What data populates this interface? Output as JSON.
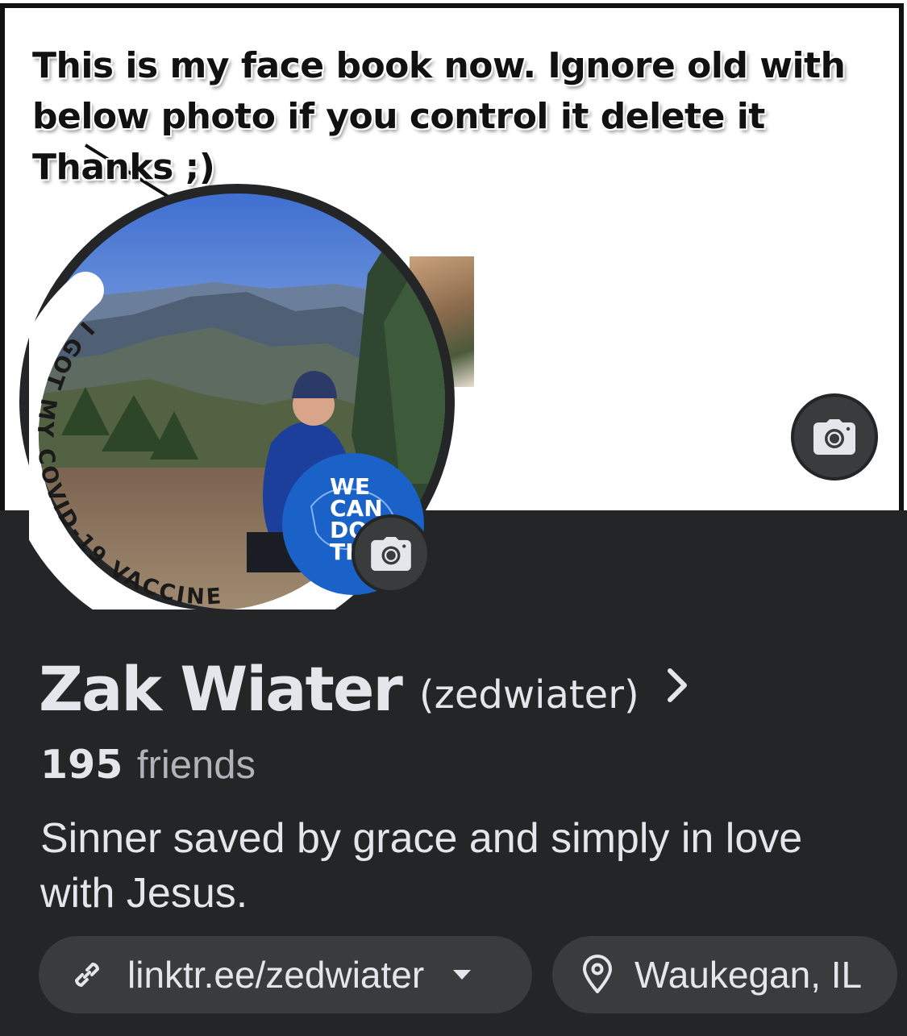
{
  "cover": {
    "caption": "This is my face book now. Ignore old with below photo if you control it delete it Thanks ;)",
    "camera_icon": "camera-icon"
  },
  "avatar": {
    "frame_text": "I GOT MY COVID-19 VACCINE",
    "badge_text": [
      "WE",
      "CAN",
      "DO",
      "TH"
    ],
    "camera_icon": "camera-icon"
  },
  "profile": {
    "name": "Zak Wiater",
    "username": "(zedwiater)",
    "friends_count": "195",
    "friends_label": "friends",
    "bio": "Sinner saved by grace and simply in love with Jesus."
  },
  "chips": {
    "link": {
      "icon": "link-icon",
      "text": "linktr.ee/zedwiater",
      "caret_icon": "caret-down-icon"
    },
    "location": {
      "icon": "location-pin-icon",
      "text": "Waukegan, IL"
    }
  },
  "colors": {
    "background": "#242526",
    "chip": "#3a3b3c",
    "text_primary": "#e4e6eb",
    "text_secondary": "#b0b3b8",
    "badge_blue": "#1a62c8"
  }
}
